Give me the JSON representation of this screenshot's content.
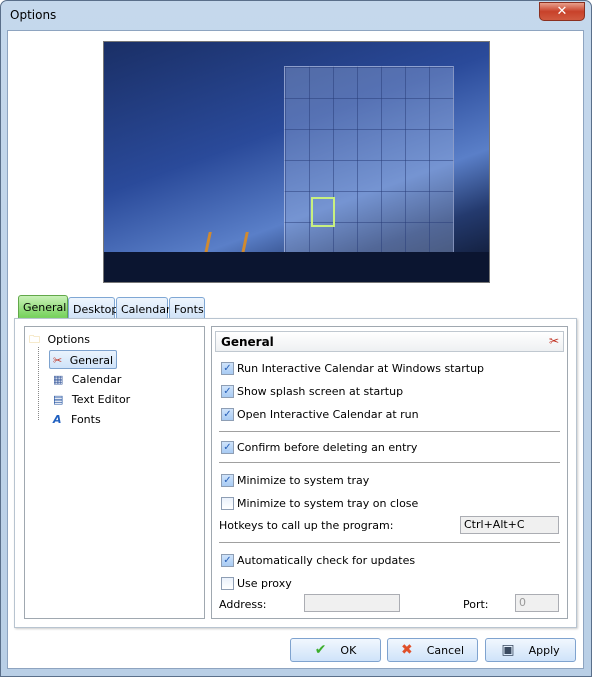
{
  "window": {
    "title": "Options",
    "close_glyph": "✕"
  },
  "tabs": [
    {
      "label": "General",
      "active": true
    },
    {
      "label": "Desktop"
    },
    {
      "label": "Calendar"
    },
    {
      "label": "Fonts"
    }
  ],
  "tree": {
    "root": "Options",
    "items": [
      {
        "label": "General",
        "icon": "tools-icon",
        "selected": true
      },
      {
        "label": "Calendar",
        "icon": "calendar-icon"
      },
      {
        "label": "Text Editor",
        "icon": "text-editor-icon"
      },
      {
        "label": "Fonts",
        "icon": "fonts-icon"
      }
    ]
  },
  "general": {
    "header": "General",
    "run_at_startup": {
      "label": "Run Interactive Calendar at Windows startup",
      "checked": true
    },
    "splash": {
      "label": "Show splash screen at startup",
      "checked": true
    },
    "open_at_run": {
      "label": "Open Interactive Calendar at run",
      "checked": true
    },
    "confirm_delete": {
      "label": "Confirm before deleting an entry",
      "checked": true
    },
    "minimize_tray": {
      "label": "Minimize to system tray",
      "checked": true
    },
    "minimize_close": {
      "label": "Minimize to system tray on close",
      "checked": false
    },
    "hotkeys_label": "Hotkeys to call up the program:",
    "hotkeys_value": "Ctrl+Alt+C",
    "auto_update": {
      "label": "Automatically check for updates",
      "checked": true
    },
    "use_proxy": {
      "label": "Use proxy",
      "checked": false
    },
    "address_label": "Address:",
    "address_value": "",
    "port_label": "Port:",
    "port_value": "0"
  },
  "buttons": {
    "ok": "OK",
    "cancel": "Cancel",
    "apply": "Apply"
  },
  "colors": {
    "active_tab": "#6fcf54",
    "close_button": "#c8412a"
  }
}
